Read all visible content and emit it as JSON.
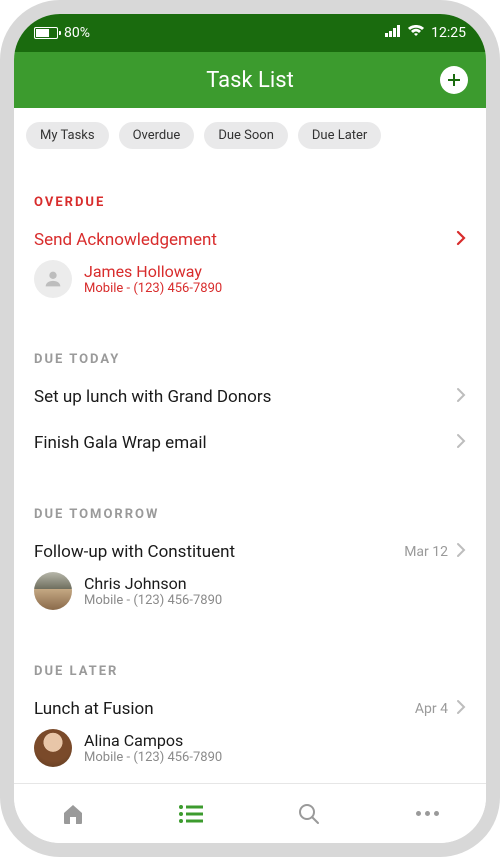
{
  "status": {
    "battery": "80%",
    "time": "12:25"
  },
  "header": {
    "title": "Task List"
  },
  "filters": {
    "my_tasks": "My Tasks",
    "overdue": "Overdue",
    "due_soon": "Due Soon",
    "due_later": "Due Later"
  },
  "sections": {
    "overdue": {
      "label": "OVERDUE",
      "tasks": [
        {
          "title": "Send Acknowledgement",
          "contact": {
            "name": "James Holloway",
            "phone": "Mobile - (123) 456-7890"
          }
        }
      ]
    },
    "due_today": {
      "label": "DUE TODAY",
      "tasks": [
        {
          "title": "Set up lunch with Grand Donors"
        },
        {
          "title": "Finish Gala Wrap email"
        }
      ]
    },
    "due_tomorrow": {
      "label": "DUE TOMORROW",
      "tasks": [
        {
          "title": "Follow-up with Constituent",
          "date": "Mar 12",
          "contact": {
            "name": "Chris Johnson",
            "phone": "Mobile - (123) 456-7890"
          }
        }
      ]
    },
    "due_later": {
      "label": "DUE LATER",
      "tasks": [
        {
          "title": "Lunch at Fusion",
          "date": "Apr 4",
          "contact": {
            "name": "Alina Campos",
            "phone": "Mobile - (123) 456-7890"
          }
        }
      ]
    }
  }
}
